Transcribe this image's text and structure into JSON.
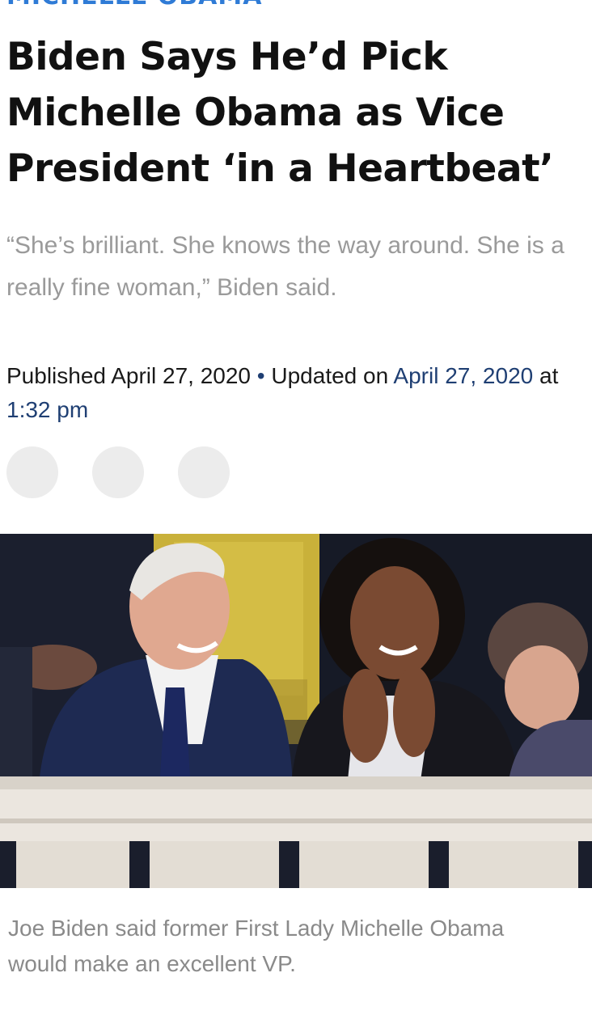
{
  "article": {
    "kicker": "Michelle Obama",
    "headline": "Biden Says He’d Pick Michelle Obama as Vice President ‘in a Heartbeat’",
    "dek": "“She’s brilliant. She knows the way around. She is a really fine woman,” Biden said.",
    "byline": {
      "published_label": "Published",
      "published_date": "April 27, 2020",
      "separator": "•",
      "updated_label": "Updated on",
      "updated_date": "April 27, 2020",
      "at_label": "at",
      "updated_time": "1:32 pm"
    },
    "share_buttons": [
      {
        "icon": "share-icon-1"
      },
      {
        "icon": "share-icon-2"
      },
      {
        "icon": "share-icon-3"
      }
    ],
    "caption": "Joe Biden said former First Lady Michelle Obama would make an excellent VP."
  },
  "colors": {
    "kicker": "#2f7bd6",
    "link": "#1f3f73",
    "dek": "#9a9a9a",
    "caption": "#8a8a8a",
    "share_button": "#ececec"
  }
}
